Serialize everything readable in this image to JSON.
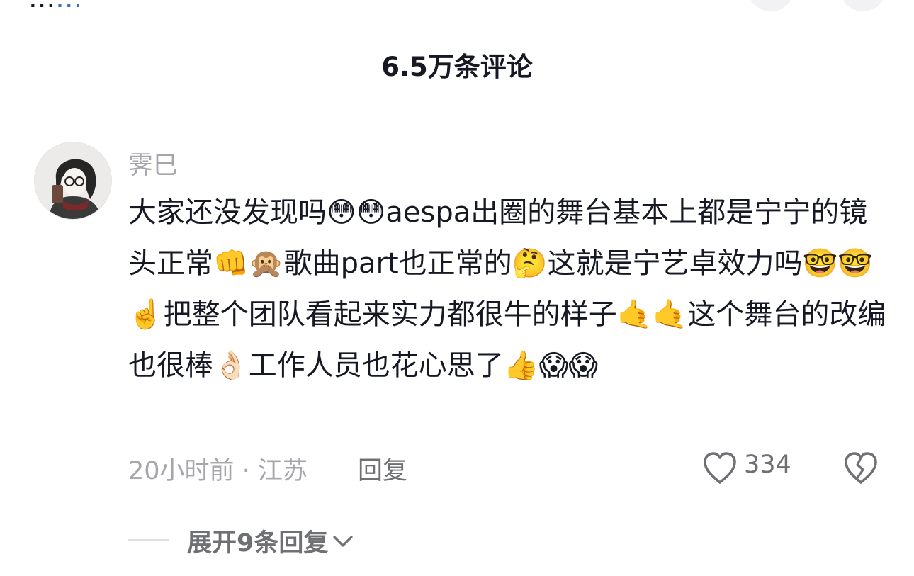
{
  "top": {
    "partial_text": "...",
    "partial_link": "..."
  },
  "comments_header": {
    "count_title": "6.5万条评论"
  },
  "comment": {
    "username": "霁巳",
    "text": "大家还没发现吗😳😳aespa出圈的舞台基本上都是宁宁的镜头正常👊🙊歌曲part也正常的🤔这就是宁艺卓效力吗🤓🤓☝️把整个团队看起来实力都很牛的样子🤙🤙这个舞台的改编也很棒👌🏻工作人员也花心思了👍😱😱",
    "time": "20小时前",
    "separator": "·",
    "location": "江苏",
    "reply_label": "回复",
    "like_count": "334"
  },
  "replies": {
    "expand_label": "展开9条回复"
  },
  "icons": {
    "like": "heart-outline-icon",
    "dislike": "broken-heart-icon",
    "expand": "chevron-down-icon"
  },
  "colors": {
    "primary_text": "#161823",
    "secondary_text": "#a5a6ab",
    "action_text": "#6f7074"
  }
}
